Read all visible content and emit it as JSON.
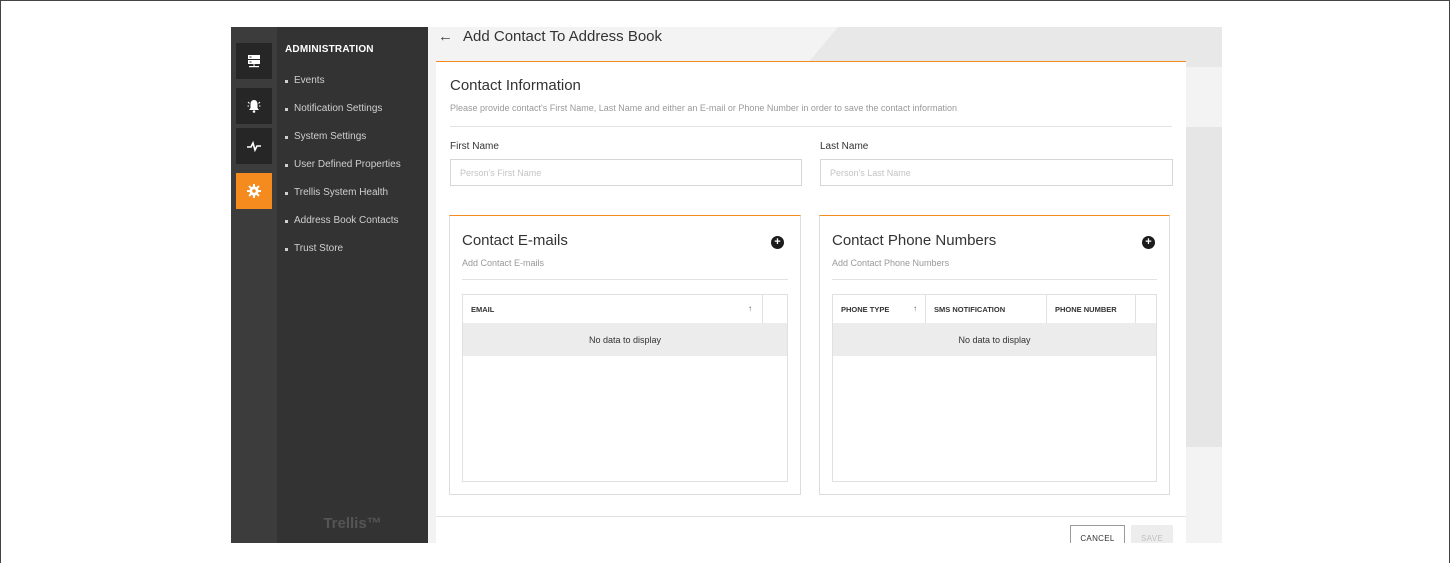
{
  "sidebar": {
    "icons": [
      {
        "name": "server-icon",
        "active": false
      },
      {
        "name": "alarm-bell-icon",
        "active": false
      },
      {
        "name": "pulse-icon",
        "active": false
      },
      {
        "name": "gear-icon",
        "active": true
      }
    ],
    "title": "ADMINISTRATION",
    "items": [
      {
        "label": "Events"
      },
      {
        "label": "Notification Settings"
      },
      {
        "label": "System Settings"
      },
      {
        "label": "User Defined Properties"
      },
      {
        "label": "Trellis System Health"
      },
      {
        "label": "Address Book Contacts"
      },
      {
        "label": "Trust Store"
      }
    ],
    "brand": "Trellis™"
  },
  "header": {
    "back_icon": "back-arrow-icon",
    "title": "Add Contact To Address Book"
  },
  "contact_info": {
    "title": "Contact Information",
    "description": "Please provide contact's First Name, Last Name and either an E-mail or Phone Number in order to save the contact information",
    "first_name": {
      "label": "First Name",
      "placeholder": "Person's First Name",
      "value": ""
    },
    "last_name": {
      "label": "Last Name",
      "placeholder": "Person's Last Name",
      "value": ""
    }
  },
  "emails": {
    "title": "Contact E-mails",
    "description": "Add Contact E-mails",
    "add_icon": "plus-circle-icon",
    "columns": [
      "EMAIL"
    ],
    "sort_indicator": "↑",
    "empty_text": "No data to display"
  },
  "phones": {
    "title": "Contact Phone Numbers",
    "description": "Add Contact Phone Numbers",
    "add_icon": "plus-circle-icon",
    "columns": [
      "PHONE TYPE",
      "SMS NOTIFICATION",
      "PHONE NUMBER"
    ],
    "sort_indicator": "↑",
    "empty_text": "No data to display"
  },
  "footer": {
    "cancel_label": "CANCEL",
    "save_label": "SAVE"
  },
  "colors": {
    "accent": "#f58a1f",
    "sidebar_bg": "#333333",
    "rail_bg": "#3c3c3c"
  }
}
